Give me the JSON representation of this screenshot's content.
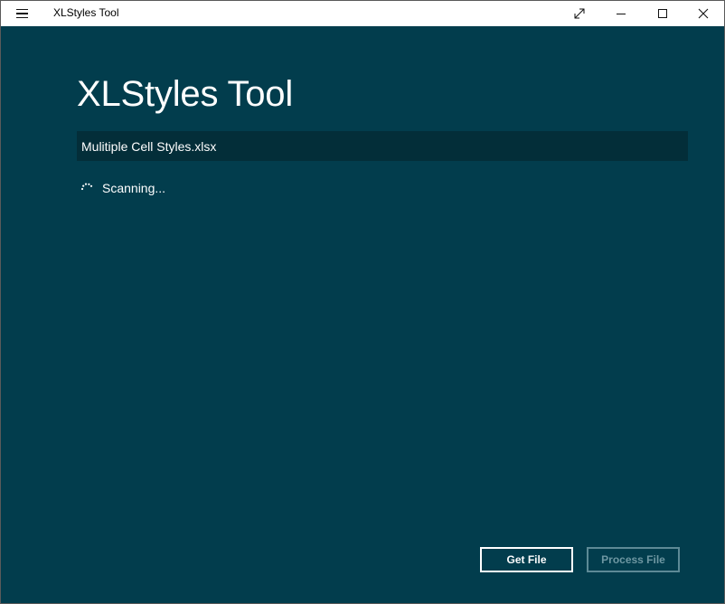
{
  "window": {
    "title": "XLStyles Tool",
    "controls": {
      "fullscreen": "fullscreen-icon",
      "minimize": "minimize-icon",
      "maximize": "maximize-icon",
      "close": "close-icon"
    }
  },
  "main": {
    "heading": "XLStyles Tool",
    "file_name": "Mulitiple Cell Styles.xlsx",
    "status_text": "Scanning...",
    "buttons": {
      "get_file": "Get File",
      "process_file": "Process File"
    }
  },
  "colors": {
    "content_background": "#023d4d",
    "file_field_background": "#032e39",
    "text": "#ffffff",
    "disabled_button": "#6e97a2"
  }
}
